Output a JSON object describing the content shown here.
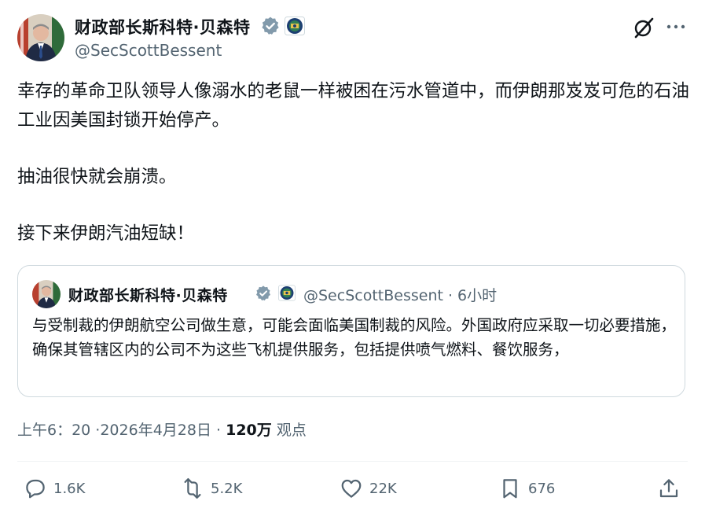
{
  "author": {
    "name": "财政部长斯科特·贝森特",
    "handle": "@SecScottBessent",
    "verified_color": "#829aab"
  },
  "tweet": {
    "paragraphs": [
      "幸存的革命卫队领导人像溺水的老鼠一样被困在污水管道中，而伊朗那岌岌可危的石油工业因美国封锁开始停产。",
      "抽油很快就会崩溃。",
      "接下来伊朗汽油短缺！"
    ]
  },
  "quote": {
    "name": "财政部长斯科特·贝森特",
    "handle_time": "@SecScottBessent · 6小时",
    "text": "与受制裁的伊朗航空公司做生意，可能会面临美国制裁的风险。外国政府应采取一切必要措施，确保其管辖区内的公司不为这些飞机提供服务，包括提供喷气燃料、餐饮服务，"
  },
  "meta": {
    "timestamp": "上午6：20 ·2026年4月28日 ·",
    "views_count": "120万",
    "views_label": "观点"
  },
  "actions": {
    "replies": "1.6K",
    "reposts": "5.2K",
    "likes": "22K",
    "bookmarks": "676"
  },
  "icons": [
    "more-icon",
    "grok-icon",
    "reply-icon",
    "repost-icon",
    "like-icon",
    "bookmark-icon",
    "share-icon"
  ]
}
